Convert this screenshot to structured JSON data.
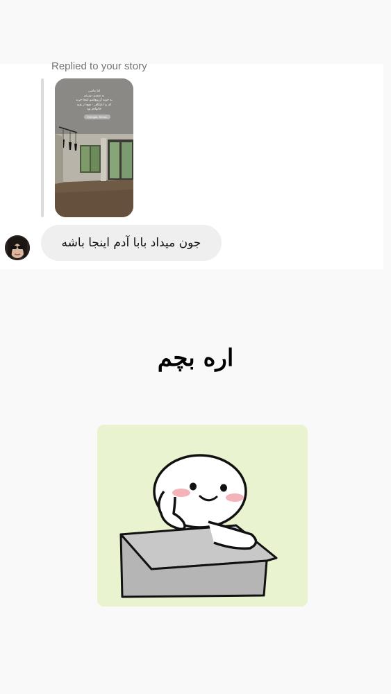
{
  "reply": {
    "label": "Replied to your story",
    "story_caption": "اما ماسی\nیه نفسم دوستم\nبه خونه آرزوهاشو اینجا خرید\nکه یه اعتکاف - هیچ از بقیه\nخانوادم بود",
    "story_location": "Velenjak, Tehran"
  },
  "message": {
    "text": "جون میداد بابا آدم اینجا باشه"
  },
  "overlay": {
    "caption": "اره بچم"
  },
  "colors": {
    "page_background": "#f9f9f9",
    "card_background": "#ffffff",
    "bubble_background": "#efefef",
    "muted_text": "#737373",
    "sticker_background": "#eaf3cf"
  }
}
